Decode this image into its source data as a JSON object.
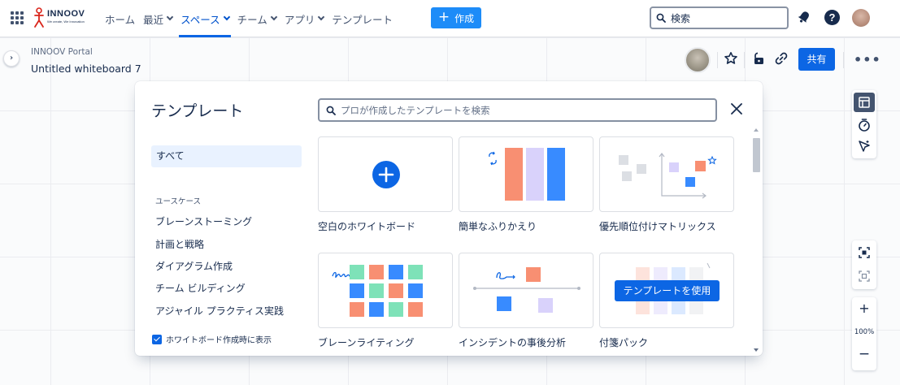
{
  "nav": {
    "logo_text": "INNOOV",
    "logo_sub": "We create, We Innovation",
    "items": [
      {
        "label": "ホーム",
        "has_dropdown": false
      },
      {
        "label": "最近",
        "has_dropdown": true
      },
      {
        "label": "スペース",
        "has_dropdown": true,
        "active": true
      },
      {
        "label": "チーム",
        "has_dropdown": true
      },
      {
        "label": "アプリ",
        "has_dropdown": true
      },
      {
        "label": "テンプレート",
        "has_dropdown": false
      }
    ],
    "create_label": "作成",
    "search_label": "検索"
  },
  "page": {
    "breadcrumb": "INNOOV Portal",
    "title": "Untitled whiteboard 7",
    "share_label": "共有",
    "more_label": "•••"
  },
  "zoom": {
    "plus": "+",
    "level": "100%",
    "minus": "−"
  },
  "modal": {
    "title": "テンプレート",
    "search_placeholder": "プロが作成したテンプレートを検索",
    "all_label": "すべて",
    "usecase_heading": "ユースケース",
    "categories": [
      "ブレーンストーミング",
      "計画と戦略",
      "ダイアグラム作成",
      "チーム ビルディング",
      "アジャイル プラクティス実践"
    ],
    "show_on_create": "ホワイトボード作成時に表示",
    "use_template_label": "テンプレートを使用",
    "templates": [
      {
        "label": "空白のホワイトボード"
      },
      {
        "label": "簡単なふりかえり"
      },
      {
        "label": "優先順位付けマトリックス"
      },
      {
        "label": "ブレーンライティング"
      },
      {
        "label": "インシデントの事後分析"
      },
      {
        "label": "付箋パック"
      }
    ]
  },
  "colors": {
    "brand_blue": "#0c66e4",
    "create_blue": "#1d8cf8",
    "selected_bg": "#e9f2ff"
  }
}
